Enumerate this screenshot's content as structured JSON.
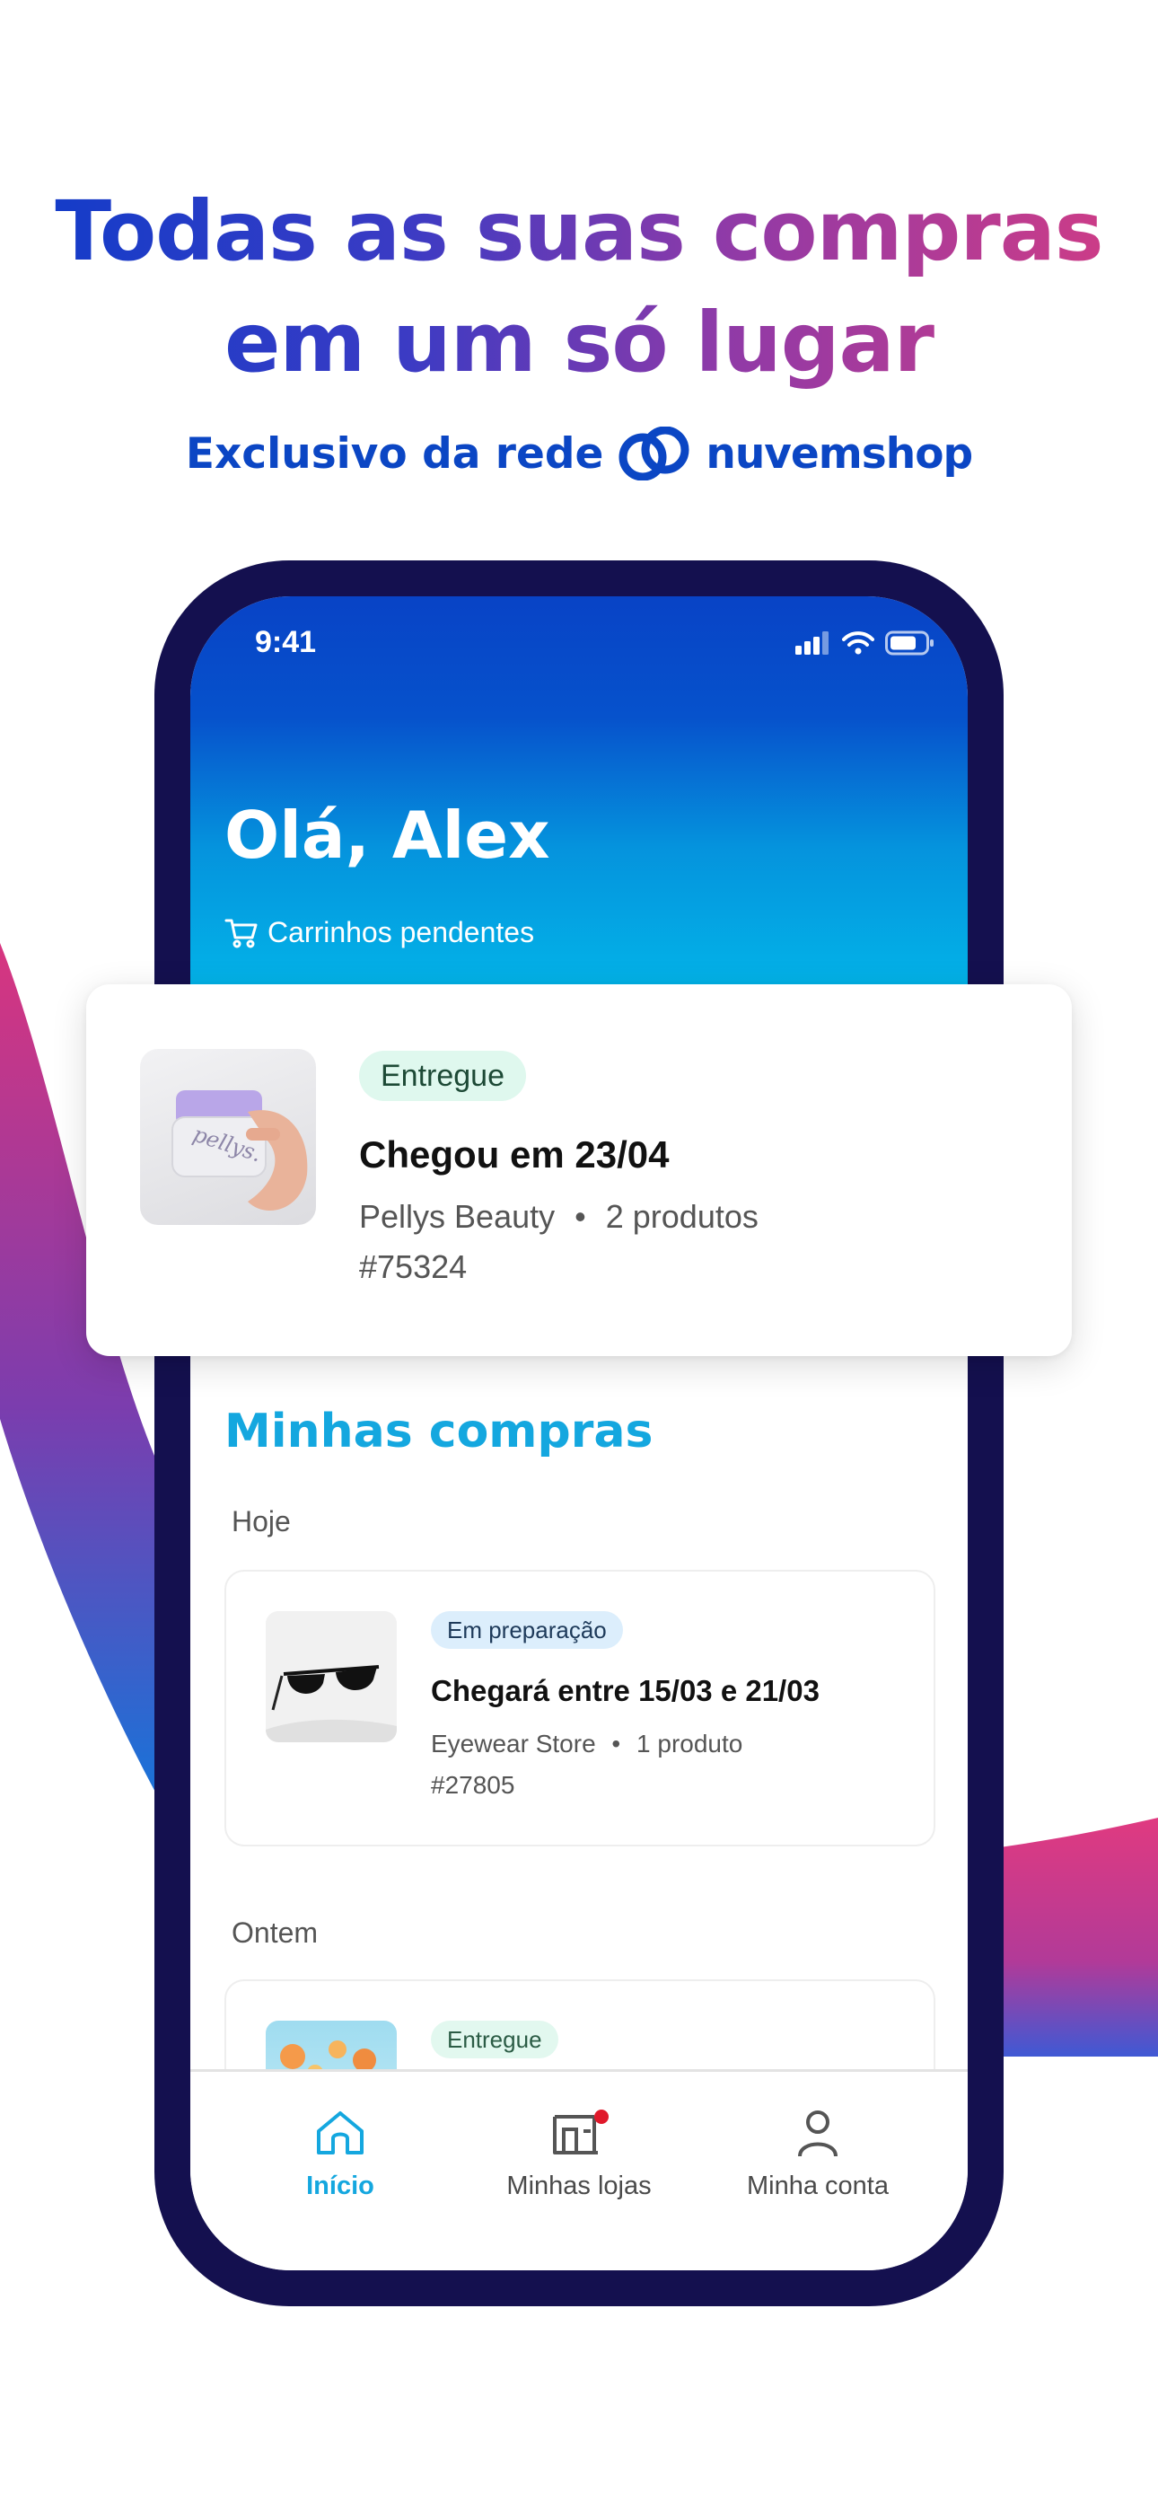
{
  "marketing": {
    "headline_line1": "Todas as suas compras",
    "headline_line2": "em um só lugar",
    "exclusive_text": "Exclusivo da rede",
    "brand_name": "nuvemshop"
  },
  "status_bar": {
    "time": "9:41"
  },
  "header": {
    "greeting": "Olá, Alex",
    "pending_carts_label": "Carrinhos pendentes"
  },
  "highlight_order": {
    "status": "Entregue",
    "title": "Chegou em 23/04",
    "store": "Pellys Beauty",
    "products": "2 produtos",
    "order_id": "#75324",
    "product_brand": "pellys."
  },
  "purchases": {
    "title": "Minhas compras",
    "groups": [
      {
        "label": "Hoje",
        "order": {
          "status": "Em preparação",
          "title": "Chegará entre 15/03 e 21/03",
          "store": "Eyewear Store",
          "products": "1 produto",
          "order_id": "#27805"
        }
      },
      {
        "label": "Ontem",
        "order": {
          "status": "Entregue"
        }
      }
    ]
  },
  "tabbar": {
    "tabs": [
      {
        "label": "Início",
        "icon": "home-icon",
        "active": true
      },
      {
        "label": "Minhas lojas",
        "icon": "store-icon",
        "notification": true
      },
      {
        "label": "Minha conta",
        "icon": "user-icon"
      }
    ]
  },
  "colors": {
    "brand_blue": "#0b46c4",
    "accent_cyan": "#14a7df",
    "notification_red": "#e0192b",
    "frame": "#14104f"
  }
}
